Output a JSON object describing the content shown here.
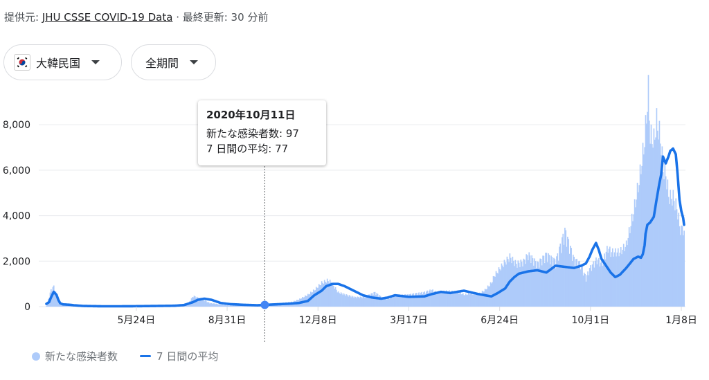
{
  "header": {
    "prefix": "提供元:",
    "source_link": "JHU CSSE COVID-19 Data",
    "suffix": "· 最終更新: 30 分前"
  },
  "filters": {
    "country": "大韓民国",
    "period": "全期間"
  },
  "tooltip": {
    "date": "2020年10月11日",
    "new_cases": "新たな感染者数: 97",
    "avg": "7 日間の平均: 77"
  },
  "legend": {
    "bars_label": "新たな感染者数",
    "line_label": "7 日間の平均"
  },
  "colors": {
    "bars": "#aecbfa",
    "line": "#1a73e8",
    "grid": "#e8eaed",
    "marker": "#4285f4"
  },
  "chart_data": {
    "type": "bar",
    "ylim": [
      0,
      9200
    ],
    "yticks": [
      0,
      2000,
      4000,
      6000,
      8000
    ],
    "ytick_labels": [
      "0",
      "2,000",
      "4,000",
      "6,000",
      "8,000"
    ],
    "xtick_labels": [
      "5月24日",
      "8月31日",
      "12月8日",
      "3月17日",
      "6月24日",
      "10月1日",
      "1月8日"
    ],
    "xtick_days": [
      98,
      197,
      296,
      395,
      494,
      593,
      692
    ],
    "highlight": {
      "label": "2020年10月11日",
      "day": 238,
      "new_cases": 97,
      "avg": 77
    },
    "series": [
      {
        "name": "新たな感染者数",
        "kind": "bars",
        "knots_day": [
          0,
          5,
          8,
          11,
          12,
          15,
          18,
          20,
          22,
          24,
          30,
          45,
          60,
          90,
          120,
          145,
          155,
          160,
          170,
          178,
          185,
          190,
          200,
          220,
          235,
          240,
          255,
          268,
          275,
          285,
          292,
          300,
          306,
          310,
          318,
          326,
          336,
          346,
          358,
          366,
          372,
          380,
          394,
          412,
          420,
          425,
          438,
          448,
          456,
          462,
          470,
          478,
          485,
          488,
          498,
          505,
          512,
          520,
          525,
          535,
          545,
          555,
          565,
          575,
          582,
          585,
          588,
          592,
          600,
          605,
          612,
          615,
          625,
          632,
          640,
          646,
          652,
          656,
          658,
          662,
          665,
          668,
          670,
          672,
          675,
          678,
          680,
          683,
          685,
          688,
          690,
          692,
          693,
          694,
          695
        ],
        "knots_value": [
          50,
          700,
          850,
          500,
          300,
          100,
          120,
          120,
          70,
          70,
          30,
          25,
          35,
          45,
          40,
          40,
          160,
          450,
          300,
          150,
          120,
          80,
          45,
          50,
          80,
          110,
          150,
          200,
          300,
          500,
          700,
          1000,
          1100,
          1050,
          600,
          500,
          400,
          400,
          600,
          380,
          350,
          480,
          500,
          600,
          700,
          600,
          650,
          600,
          500,
          550,
          500,
          700,
          1000,
          1300,
          1800,
          2100,
          1800,
          1900,
          2200,
          1800,
          2200,
          1900,
          3200,
          2000,
          1800,
          1500,
          1200,
          1600,
          2000,
          1800,
          2500,
          2300,
          2300,
          2600,
          4000,
          5300,
          7000,
          9100,
          7200,
          7000,
          7800,
          7300,
          6800,
          5800,
          5600,
          4700,
          4600,
          4600,
          4400,
          4000,
          3400,
          3200,
          3400,
          3300,
          3000
        ]
      },
      {
        "name": "7 日間の平均",
        "kind": "line",
        "knots_day": [
          0,
          3,
          5,
          8,
          11,
          13,
          15,
          18,
          22,
          26,
          30,
          40,
          60,
          80,
          100,
          120,
          140,
          150,
          160,
          165,
          172,
          180,
          190,
          200,
          215,
          230,
          238,
          255,
          265,
          275,
          285,
          292,
          300,
          305,
          312,
          318,
          325,
          335,
          345,
          355,
          365,
          372,
          380,
          395,
          412,
          420,
          430,
          440,
          455,
          470,
          478,
          485,
          492,
          500,
          505,
          510,
          515,
          520,
          525,
          535,
          545,
          555,
          565,
          575,
          583,
          588,
          592,
          595,
          599,
          602,
          605,
          610,
          615,
          620,
          625,
          632,
          640,
          645,
          648,
          650,
          652,
          653,
          655,
          658,
          662,
          665,
          668,
          670,
          672,
          675,
          678,
          680,
          683,
          686,
          688,
          690,
          692,
          694
        ],
        "knots_value": [
          120,
          200,
          400,
          650,
          520,
          300,
          150,
          100,
          90,
          80,
          60,
          30,
          15,
          15,
          20,
          30,
          40,
          70,
          200,
          300,
          350,
          300,
          160,
          110,
          80,
          60,
          77,
          110,
          130,
          160,
          250,
          500,
          700,
          900,
          1000,
          1000,
          900,
          700,
          500,
          400,
          350,
          400,
          500,
          430,
          450,
          550,
          650,
          600,
          700,
          560,
          500,
          450,
          600,
          800,
          1100,
          1300,
          1450,
          1500,
          1550,
          1600,
          1500,
          1800,
          1750,
          1700,
          1800,
          1900,
          2200,
          2500,
          2800,
          2500,
          2100,
          1800,
          1500,
          1300,
          1400,
          1700,
          2100,
          2200,
          2150,
          2300,
          2700,
          3200,
          3600,
          3700,
          3950,
          4700,
          5400,
          5800,
          6600,
          6300,
          6600,
          6850,
          6950,
          6700,
          5800,
          4700,
          4200,
          3900,
          3600
        ]
      }
    ]
  }
}
